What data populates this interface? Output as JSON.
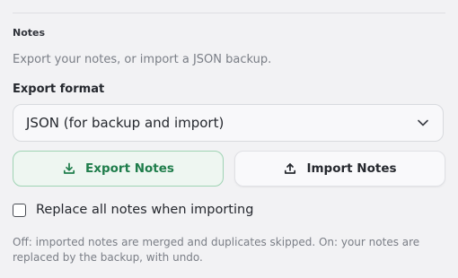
{
  "notes": {
    "title": "Notes",
    "description": "Export your notes, or import a JSON backup.",
    "export_format": {
      "label": "Export format",
      "selected": "JSON (for backup and import)",
      "icon": "chevron-down-icon"
    },
    "export_button": {
      "label": "Export Notes",
      "icon": "download-icon",
      "color": "#1f7d4b"
    },
    "import_button": {
      "label": "Import Notes",
      "icon": "upload-icon"
    },
    "replace_option": {
      "label": "Replace all notes when importing",
      "checked": false
    },
    "help": "Off: imported notes are merged and duplicates skipped. On: your notes are replaced by the backup, with undo."
  }
}
